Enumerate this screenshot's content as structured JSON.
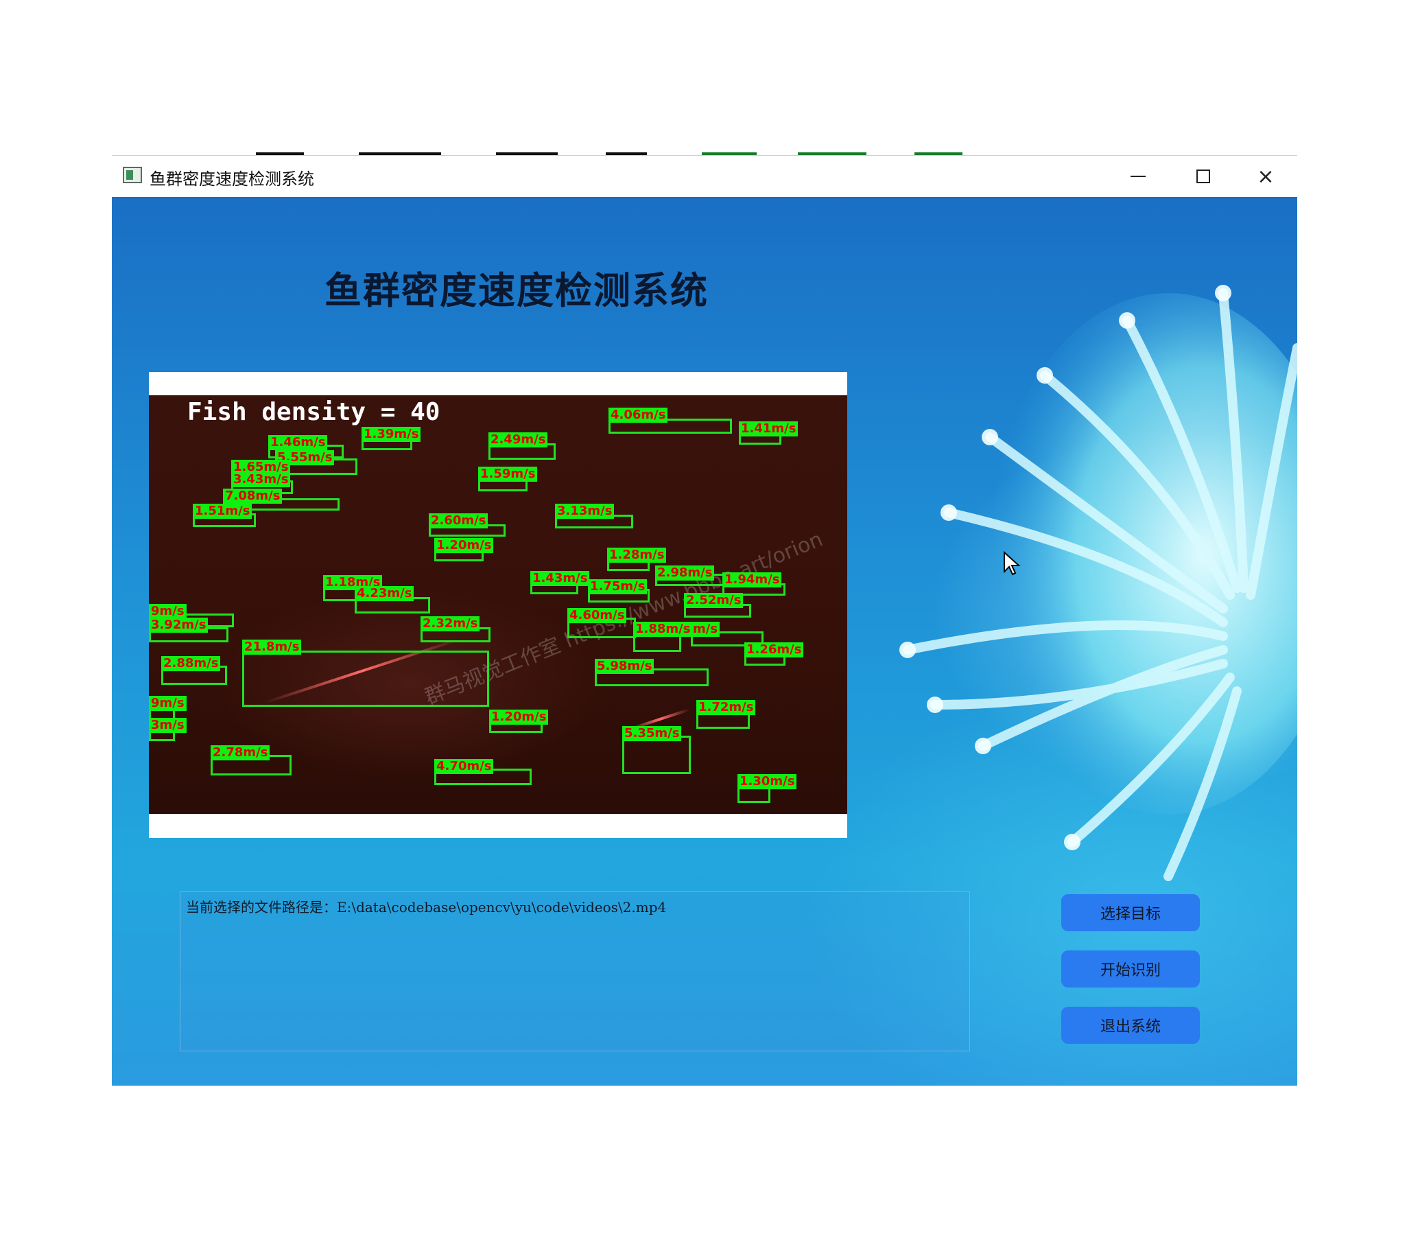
{
  "window": {
    "title": "鱼群密度速度检测系统",
    "minimize_glyph": "minimize-icon",
    "maximize_glyph": "maximize-icon",
    "close_glyph": "×"
  },
  "app": {
    "heading": "鱼群密度速度检测系统"
  },
  "video": {
    "density_text": "Fish density = 40",
    "watermark": "群马视觉工作室  https://www.bbbn.art/orion",
    "detections": [
      {
        "label": "4.06m/s"
      },
      {
        "label": "1.41m/s"
      },
      {
        "label": "1.39m/s"
      },
      {
        "label": "1.46m/s"
      },
      {
        "label": "5.55m/s"
      },
      {
        "label": "1.65m/s"
      },
      {
        "label": "2.49m/s"
      },
      {
        "label": "1.59m/s"
      },
      {
        "label": "3.43m/s"
      },
      {
        "label": "7.08m/s"
      },
      {
        "label": "1.51m/s"
      },
      {
        "label": "2.60m/s"
      },
      {
        "label": "3.13m/s"
      },
      {
        "label": "1.20m/s"
      },
      {
        "label": "1.28m/s"
      },
      {
        "label": "2.98m/s"
      },
      {
        "label": "1.43m/s"
      },
      {
        "label": "1.75m/s"
      },
      {
        "label": "1.94m/s"
      },
      {
        "label": "1.18m/s"
      },
      {
        "label": "4.23m/s"
      },
      {
        "label": "2.52m/s"
      },
      {
        "label": "9m/s"
      },
      {
        "label": "3.92m/s"
      },
      {
        "label": "4.60m/s"
      },
      {
        "label": "2.32m/s"
      },
      {
        "label": "1.88m/s"
      },
      {
        "label": "m/s"
      },
      {
        "label": "21.8m/s"
      },
      {
        "label": "1.26m/s"
      },
      {
        "label": "2.88m/s"
      },
      {
        "label": "5.98m/s"
      },
      {
        "label": "9m/s"
      },
      {
        "label": "3m/s"
      },
      {
        "label": "1.20m/s"
      },
      {
        "label": "1.72m/s"
      },
      {
        "label": "5.35m/s"
      },
      {
        "label": "2.78m/s"
      },
      {
        "label": "4.70m/s"
      },
      {
        "label": "1.30m/s"
      }
    ]
  },
  "path_box": {
    "text": "当前选择的文件路径是：E:\\data\\codebase\\opencv\\yu\\code\\videos\\2.mp4"
  },
  "buttons": {
    "select": "选择目标",
    "start": "开始识别",
    "exit": "退出系统"
  },
  "colors": {
    "box_green": "#22e222",
    "label_bg": "#10f010",
    "label_text": "#e00000",
    "button_blue": "#2a7af0"
  }
}
